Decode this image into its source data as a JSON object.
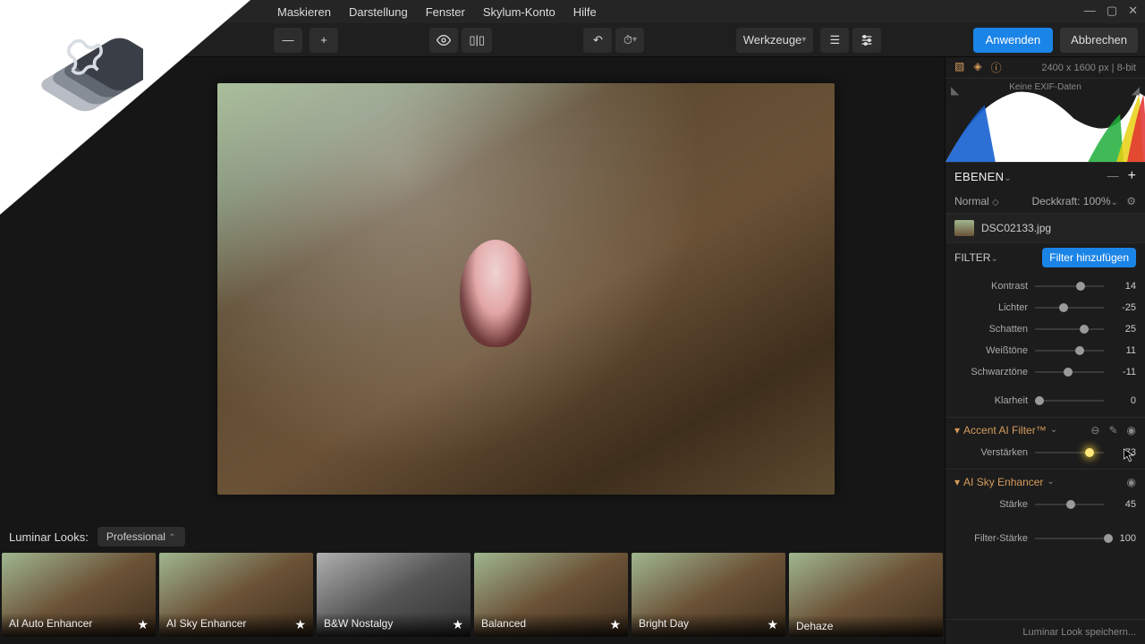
{
  "menu": {
    "items": [
      "Maskieren",
      "Darstellung",
      "Fenster",
      "Skylum-Konto",
      "Hilfe"
    ]
  },
  "toolbar": {
    "werkzeuge": "Werkzeuge",
    "apply": "Anwenden",
    "cancel": "Abbrechen"
  },
  "rightpanel": {
    "dimensions": "2400 x 1600 px",
    "bitdepth": "8-bit",
    "exif": "Keine EXIF-Daten",
    "ebenen_title": "EBENEN",
    "blend_mode": "Normal",
    "opacity_label": "Deckkraft:",
    "opacity_value": "100%",
    "layer_name": "DSC02133.jpg",
    "filter_title": "FILTER",
    "add_filter": "Filter hinzufügen",
    "basic_sliders": [
      {
        "label": "Kontrast",
        "value": 14,
        "pos": 60
      },
      {
        "label": "Lichter",
        "value": -25,
        "pos": 35
      },
      {
        "label": "Schatten",
        "value": 25,
        "pos": 65
      },
      {
        "label": "Weißtöne",
        "value": 11,
        "pos": 58
      },
      {
        "label": "Schwarztöne",
        "value": -11,
        "pos": 42
      },
      {
        "label": "Klarheit",
        "value": 0,
        "pos": 0
      }
    ],
    "accent_title": "Accent AI Filter™",
    "accent_slider": {
      "label": "Verstärken",
      "value": 73,
      "pos": 73
    },
    "sky_title": "AI Sky Enhancer",
    "sky_slider": {
      "label": "Stärke",
      "value": 45,
      "pos": 45
    },
    "strength_slider": {
      "label": "Filter-Stärke",
      "value": 100,
      "pos": 100
    },
    "save_look": "Luminar Look speichern..."
  },
  "looks": {
    "title": "Luminar Looks:",
    "category": "Professional",
    "presets": [
      "AI Auto Enhancer",
      "AI Sky Enhancer",
      "B&W Nostalgy",
      "Balanced",
      "Bright Day",
      "Dehaze"
    ]
  }
}
